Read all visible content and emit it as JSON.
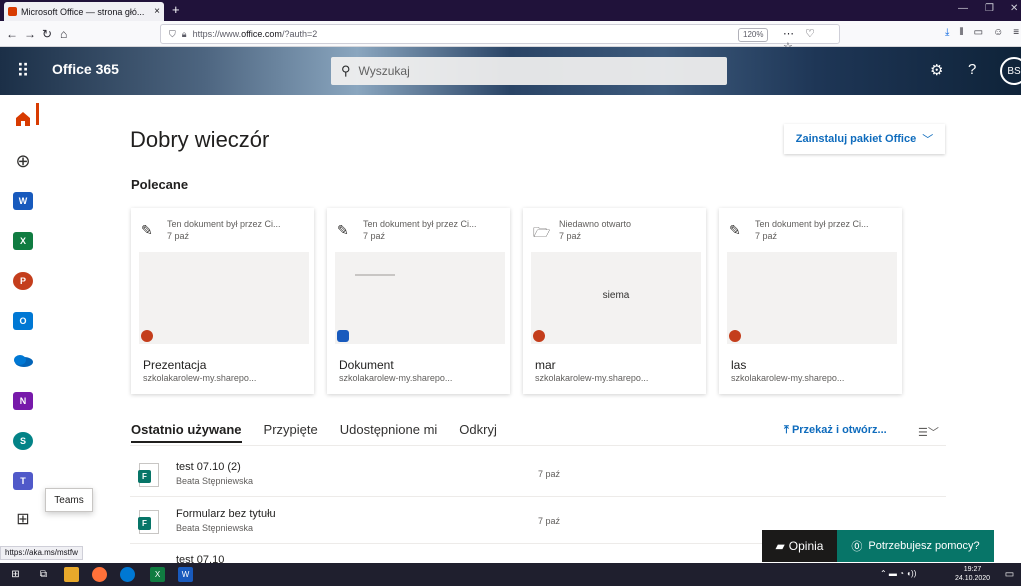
{
  "browser": {
    "tab_title": "Microsoft Office — strona głó...",
    "tab_close": "×",
    "new_tab": "+",
    "url_prefix": "https://www.",
    "url_domain": "office.com",
    "url_suffix": "/?auth=2",
    "zoom": "120%",
    "status_url": "https://aka.ms/mstfw"
  },
  "header": {
    "brand": "Office 365",
    "search_placeholder": "Wyszukaj",
    "avatar": "BS"
  },
  "rail": {
    "tooltip": "Teams",
    "apps": [
      {
        "name": "word",
        "letter": "W",
        "color": "#185abd"
      },
      {
        "name": "excel",
        "letter": "X",
        "color": "#107c41"
      },
      {
        "name": "powerpoint",
        "letter": "P",
        "color": "#c43e1c"
      },
      {
        "name": "outlook",
        "letter": "O",
        "color": "#0078d4"
      },
      {
        "name": "onedrive",
        "letter": "",
        "color": "#0364b8"
      },
      {
        "name": "onenote",
        "letter": "N",
        "color": "#7719aa"
      },
      {
        "name": "sharepoint",
        "letter": "S",
        "color": "#038387"
      },
      {
        "name": "teams",
        "letter": "T",
        "color": "#5059c9"
      }
    ]
  },
  "main": {
    "greeting": "Dobry wieczór",
    "install_label": "Zainstaluj pakiet Office",
    "recommended_title": "Polecane",
    "cards": [
      {
        "reason": "Ten dokument był przez Ci...",
        "date": "7 paź",
        "name": "Prezentacja",
        "site": "szkolakarolew-my.sharepo...",
        "badge_color": "#c43e1c",
        "preview_text": ""
      },
      {
        "reason": "Ten dokument był przez Ci...",
        "date": "7 paź",
        "name": "Dokument",
        "site": "szkolakarolew-my.sharepo...",
        "badge_color": "#185abd",
        "preview_text": ""
      },
      {
        "reason": "Niedawno otwarto",
        "date": "7 paź",
        "name": "mar",
        "site": "szkolakarolew-my.sharepo...",
        "badge_color": "#c43e1c",
        "preview_text": "siema"
      },
      {
        "reason": "Ten dokument był przez Ci...",
        "date": "7 paź",
        "name": "las",
        "site": "szkolakarolew-my.sharepo...",
        "badge_color": "#c43e1c",
        "preview_text": ""
      }
    ],
    "tabs": [
      "Ostatnio używane",
      "Przypięte",
      "Udostępnione mi",
      "Odkryj"
    ],
    "upload_label": "Przekaż i otwórz...",
    "files": [
      {
        "name": "test 07.10 (2)",
        "owner": "Beata Stępniewska",
        "date": "7 paź"
      },
      {
        "name": "Formularz bez tytułu",
        "owner": "Beata Stępniewska",
        "date": "7 paź"
      },
      {
        "name": "test 07.10",
        "owner": "",
        "date": ""
      }
    ],
    "feedback_label": "Opinia",
    "help_label": "Potrzebujesz pomocy?"
  },
  "taskbar": {
    "time": "19:27",
    "date": "24.10.2020"
  }
}
